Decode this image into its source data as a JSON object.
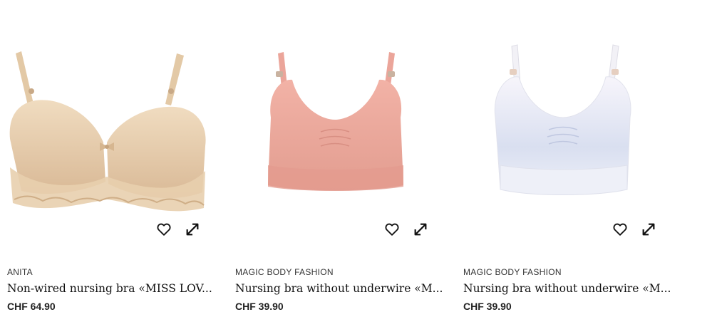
{
  "products": [
    {
      "brand": "ANITA",
      "title": "Non-wired nursing bra «MISS LOV...",
      "price": "CHF 64.90",
      "color": "#e6cba8",
      "image": "beige-lace-bra"
    },
    {
      "brand": "MAGIC BODY FASHION",
      "title": "Nursing bra without underwire «M...",
      "price": "CHF 39.90",
      "color": "#eaa79a",
      "image": "pink-seamless-bra"
    },
    {
      "brand": "MAGIC BODY FASHION",
      "title": "Nursing bra without underwire «M...",
      "price": "CHF 39.90",
      "color": "#e6e8f4",
      "image": "white-blue-seamless-bra"
    }
  ],
  "icons": {
    "favorite": "heart-icon",
    "zoom": "expand-arrows-icon"
  }
}
